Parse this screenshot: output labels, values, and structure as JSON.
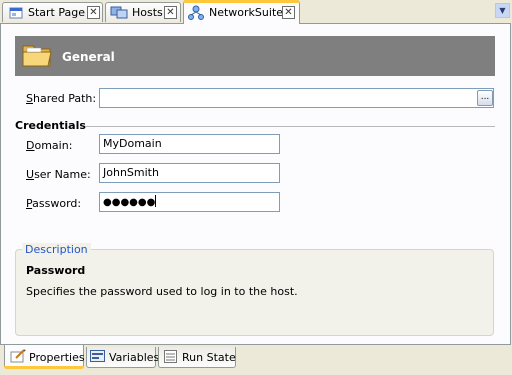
{
  "tabs": [
    {
      "label": "Start Page",
      "icon": "home-page-icon"
    },
    {
      "label": "Hosts",
      "icon": "hosts-icon"
    },
    {
      "label": "NetworkSuite",
      "icon": "network-suite-icon",
      "active": true
    }
  ],
  "header": {
    "title": "General",
    "icon": "folder-icon"
  },
  "form": {
    "shared_path": {
      "label": "Shared Path:",
      "value": "",
      "browse_label": "..."
    },
    "credentials_title": "Credentials",
    "domain": {
      "label": "Domain:",
      "value": "MyDomain"
    },
    "user_name": {
      "label": "User Name:",
      "value": "JohnSmith"
    },
    "password": {
      "label": "Password:",
      "value": "●●●●●●"
    }
  },
  "description": {
    "legend": "Description",
    "title": "Password",
    "text": "Specifies the password used to log in to the host."
  },
  "bottom_tabs": [
    {
      "label": "Properties",
      "icon": "properties-icon",
      "active": true
    },
    {
      "label": "Variables",
      "icon": "variables-icon"
    },
    {
      "label": "Run State",
      "icon": "run-state-icon"
    }
  ],
  "colors": {
    "header_bg": "#7F7F7F",
    "accent": "#FFC83C",
    "legend": "#2456C6"
  }
}
